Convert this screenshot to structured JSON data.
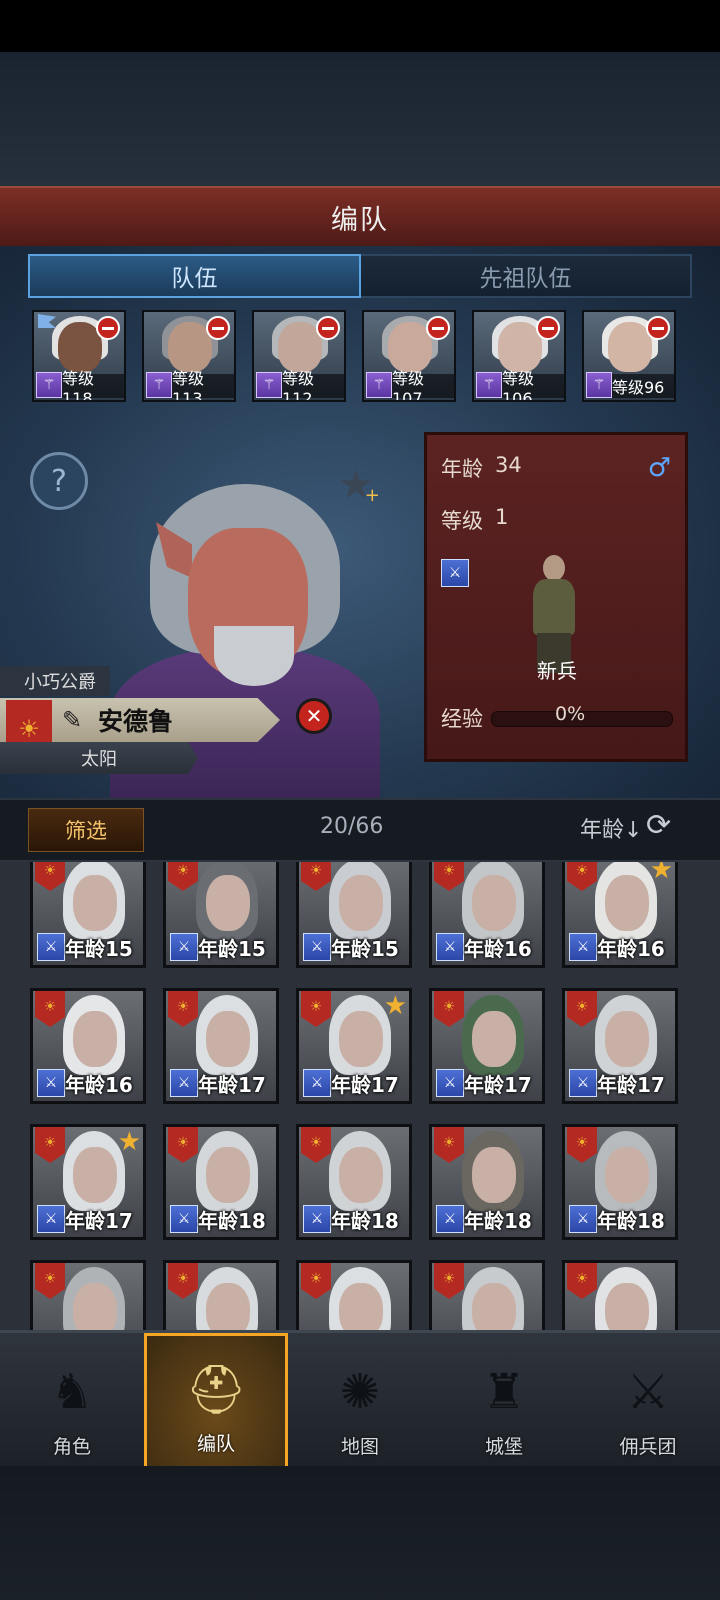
{
  "header": {
    "title": "编队"
  },
  "tabs": [
    {
      "label": "队伍",
      "active": true
    },
    {
      "label": "先祖队伍",
      "active": false
    }
  ],
  "team": [
    {
      "level": "等级118",
      "skin": "#7a5440",
      "hair": "#e2e2e2",
      "flag": true
    },
    {
      "level": "等级113",
      "skin": "#b89684",
      "hair": "#8f9398",
      "flag": false
    },
    {
      "level": "等级112",
      "skin": "#c1a699",
      "hair": "#b5b8bb",
      "flag": false
    },
    {
      "level": "等级107",
      "skin": "#c9a99c",
      "hair": "#a8abae",
      "flag": false
    },
    {
      "level": "等级106",
      "skin": "#d0b4a8",
      "hair": "#e0e2e4",
      "flag": false
    },
    {
      "level": "等级96",
      "skin": "#d3b5a6",
      "hair": "#e8e8e6",
      "flag": false
    }
  ],
  "hero": {
    "title": "小巧公爵",
    "name": "安德鲁",
    "trait": "太阳"
  },
  "info": {
    "age_label": "年龄",
    "age_value": "34",
    "level_label": "等级",
    "level_value": "1",
    "unit_name": "新兵",
    "exp_label": "经验",
    "exp_value": "0%",
    "gender_icon": "♂",
    "exp_progress": 0
  },
  "filter": {
    "button": "筛选",
    "count": "20/66",
    "sort_label": "年龄↓",
    "sort_icon": "⟳"
  },
  "roster": [
    {
      "age": "年龄15",
      "star": false,
      "hair": "#dcdfe2"
    },
    {
      "age": "年龄15",
      "star": false,
      "hair": "#6a6e73"
    },
    {
      "age": "年龄15",
      "star": false,
      "hair": "#c9ccd0"
    },
    {
      "age": "年龄16",
      "star": false,
      "hair": "#c3c6c9"
    },
    {
      "age": "年龄16",
      "star": true,
      "hair": "#e4e4e2"
    },
    {
      "age": "年龄16",
      "star": false,
      "hair": "#e4e6e8"
    },
    {
      "age": "年龄17",
      "star": false,
      "hair": "#dcdfe2"
    },
    {
      "age": "年龄17",
      "star": true,
      "hair": "#d8dbde"
    },
    {
      "age": "年龄17",
      "star": false,
      "hair": "#4a6a4e"
    },
    {
      "age": "年龄17",
      "star": false,
      "hair": "#d0d3d6"
    },
    {
      "age": "年龄17",
      "star": true,
      "hair": "#dcdfe2"
    },
    {
      "age": "年龄18",
      "star": false,
      "hair": "#d4d7da"
    },
    {
      "age": "年龄18",
      "star": false,
      "hair": "#d0d3d6"
    },
    {
      "age": "年龄18",
      "star": false,
      "hair": "#6a6660"
    },
    {
      "age": "年龄18",
      "star": false,
      "hair": "#b8bbbe"
    },
    {
      "age": "",
      "star": false,
      "hair": "#b0b3b6"
    },
    {
      "age": "",
      "star": false,
      "hair": "#d8dbde"
    },
    {
      "age": "",
      "star": false,
      "hair": "#dcdfe2"
    },
    {
      "age": "",
      "star": false,
      "hair": "#c8cbce"
    },
    {
      "age": "",
      "star": false,
      "hair": "#e0e2e4"
    }
  ],
  "nav": [
    {
      "label": "角色",
      "icon": "knight-icon",
      "glyph": "♞",
      "active": false
    },
    {
      "label": "编队",
      "icon": "helmet-icon",
      "glyph": "⛑",
      "active": true
    },
    {
      "label": "地图",
      "icon": "compass-icon",
      "glyph": "✺",
      "active": false
    },
    {
      "label": "城堡",
      "icon": "castle-icon",
      "glyph": "♜",
      "active": false
    },
    {
      "label": "佣兵团",
      "icon": "sword-fist-icon",
      "glyph": "⚔",
      "active": false
    }
  ],
  "colors": {
    "accent_gold": "#f4a624",
    "crest_red": "#b42a22",
    "tab_blue": "#5ba3e0"
  }
}
